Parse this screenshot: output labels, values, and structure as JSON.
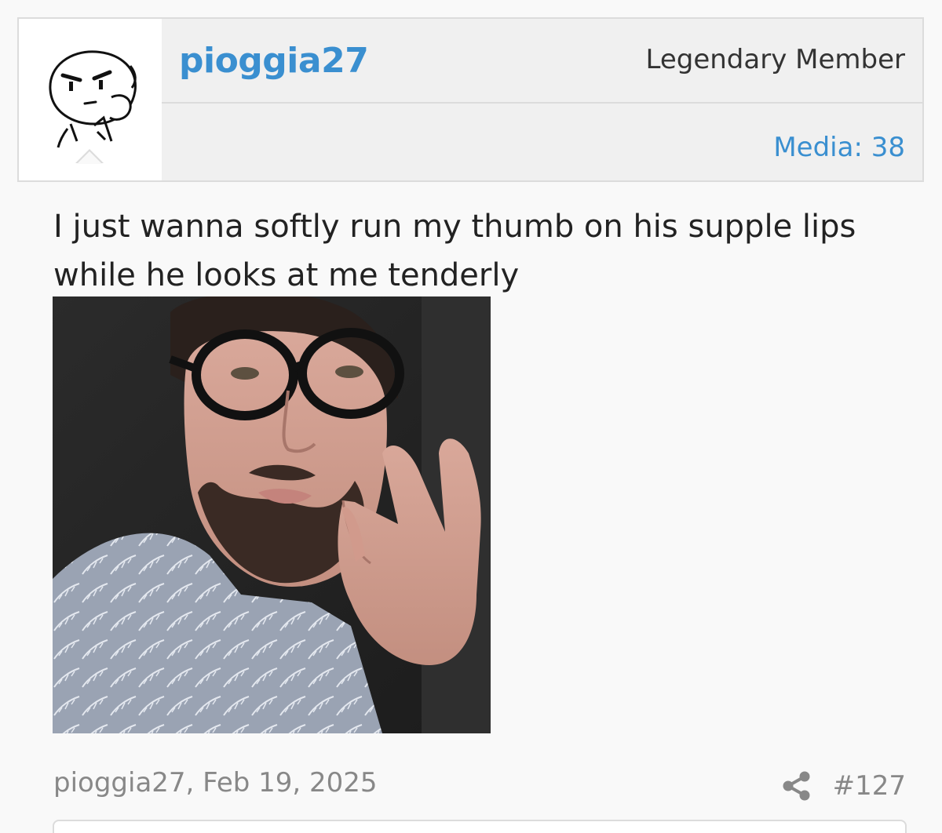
{
  "user": {
    "username": "pioggia27",
    "title": "Legendary Member",
    "media": "Media: 38",
    "avatar_icon": "cartoon-face-avatar"
  },
  "post": {
    "text": "I just wanna softly run my thumb on his supple lips while he looks at me tenderly",
    "photo_icon": "selfie-photo",
    "meta": "pioggia27, Feb 19, 2025",
    "number": "#127",
    "share_icon": "share-icon"
  },
  "colors": {
    "link": "#3a8fd0",
    "muted": "#888888",
    "border": "#dcdcdc"
  }
}
